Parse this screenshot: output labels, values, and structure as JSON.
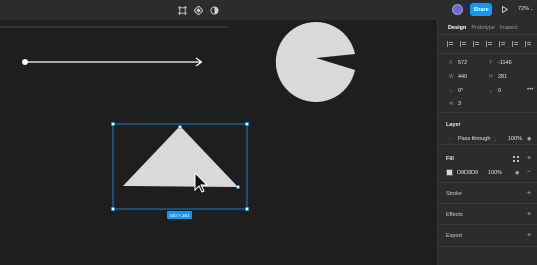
{
  "toolbar": {
    "tools": [
      "frame-icon",
      "component-icon",
      "contrast-icon"
    ],
    "share_label": "Share",
    "zoom": "72%",
    "zoom_chevron": "⌄"
  },
  "canvas": {
    "selection_size": "440 × 281"
  },
  "panel": {
    "tabs": [
      "Design",
      "Prototype",
      "Inspect"
    ],
    "position": {
      "x_label": "X",
      "x": "572",
      "y_label": "Y",
      "y": "-1146"
    },
    "size": {
      "w_label": "W",
      "w": "440",
      "h_label": "H",
      "h": "281"
    },
    "rotation": "0°",
    "corner_radius": "0",
    "count": "3",
    "layer": {
      "title": "Layer",
      "blend": "Pass through",
      "blend_chevron": "⌄",
      "opacity": "100%"
    },
    "fill": {
      "title": "Fill",
      "hex": "D9D9D9",
      "opacity": "100%",
      "color": "#d9d9d9"
    },
    "stroke": {
      "title": "Stroke"
    },
    "effects": {
      "title": "Effects"
    },
    "export": {
      "title": "Export"
    }
  },
  "colors": {
    "accent": "#0d99ff",
    "shape_fill": "#d9d9d9",
    "canvas_bg": "#1e1e1e",
    "panel_bg": "#2c2c2c"
  }
}
